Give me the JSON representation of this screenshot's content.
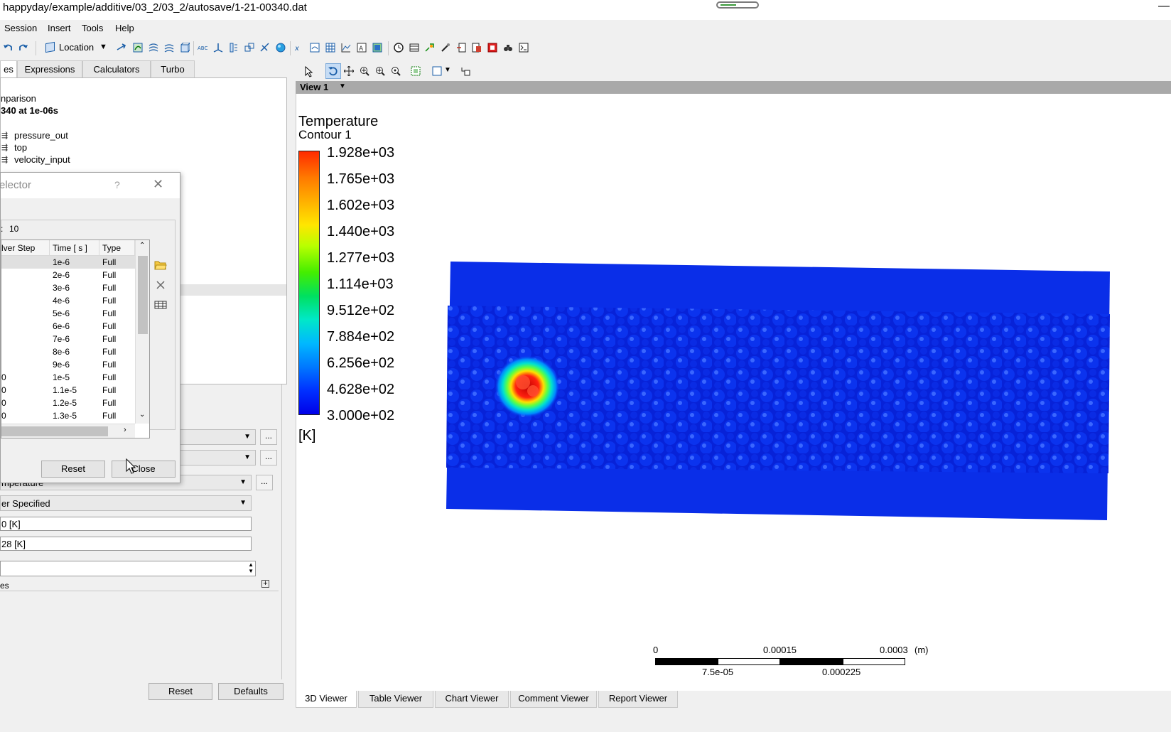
{
  "window": {
    "title": "happyday/example/additive/03_2/03_2/autosave/1-21-00340.dat",
    "minimize_glyph": "—"
  },
  "menu": [
    "Session",
    "Insert",
    "Tools",
    "Help"
  ],
  "toolbar": {
    "location_label": "Location",
    "icons": [
      "undo-icon",
      "redo-icon",
      "location-icon",
      "vector-icon",
      "streamline-icon",
      "particle-track-icon",
      "volume-rendering-icon",
      "isosurface-icon",
      "text-abc-icon",
      "coordinate-frame-icon",
      "legend-icon",
      "instance-transform-icon",
      "clip-plane-icon",
      "color-map-icon",
      "variable-icon",
      "expression-icon",
      "table-icon",
      "chart-icon",
      "comment-icon",
      "figure-icon",
      "timestep-clock-icon",
      "animation-icon",
      "quick-editor-icon",
      "probe-icon",
      "export-icon",
      "report-icon",
      "macro-icon",
      "command-editor-icon"
    ]
  },
  "left_tabs": [
    "es",
    "Expressions",
    "Calculators",
    "Turbo"
  ],
  "tree": {
    "item_comparison": "nparison",
    "item_case": "340 at 1e-06s",
    "boundaries": [
      "pressure_out",
      "top",
      "velocity_input"
    ]
  },
  "dialog": {
    "title": "elector",
    "help_glyph": "?",
    "close_glyph": "✕",
    "max_label": ":",
    "max_value": "10",
    "columns": [
      "lver Step",
      "Time [ s ]",
      "Type"
    ],
    "rows": [
      {
        "step": "",
        "time": "1e-6",
        "type": "Full"
      },
      {
        "step": "",
        "time": "2e-6",
        "type": "Full"
      },
      {
        "step": "",
        "time": "3e-6",
        "type": "Full"
      },
      {
        "step": "",
        "time": "4e-6",
        "type": "Full"
      },
      {
        "step": "",
        "time": "5e-6",
        "type": "Full"
      },
      {
        "step": "",
        "time": "6e-6",
        "type": "Full"
      },
      {
        "step": "",
        "time": "7e-6",
        "type": "Full"
      },
      {
        "step": "",
        "time": "8e-6",
        "type": "Full"
      },
      {
        "step": "",
        "time": "9e-6",
        "type": "Full"
      },
      {
        "step": "0",
        "time": "1e-5",
        "type": "Full"
      },
      {
        "step": "0",
        "time": "1.1e-5",
        "type": "Full"
      },
      {
        "step": "0",
        "time": "1.2e-5",
        "type": "Full"
      },
      {
        "step": "0",
        "time": "1.3e-5",
        "type": "Full"
      }
    ],
    "reset_label": "Reset",
    "close_label": "Close"
  },
  "details": {
    "variable_value": "mperature",
    "range_value": "er Specified",
    "min_value": "0 [K]",
    "max_value": "28 [K]",
    "spinner_value": "",
    "section_label": "es",
    "reset_label": "Reset",
    "defaults_label": "Defaults",
    "dots": "..."
  },
  "viewer": {
    "view_label": "View 1",
    "legend_title": "Temperature",
    "legend_subtitle": "Contour 1",
    "legend_values": [
      "1.928e+03",
      "1.765e+03",
      "1.602e+03",
      "1.440e+03",
      "1.277e+03",
      "1.114e+03",
      "9.512e+02",
      "7.884e+02",
      "6.256e+02",
      "4.628e+02",
      "3.000e+02"
    ],
    "legend_unit": "[K]",
    "scale": {
      "top_labels": [
        "0",
        "0.00015",
        "0.0003"
      ],
      "unit": "(m)",
      "bottom_labels": [
        "7.5e-05",
        "0.000225"
      ]
    }
  },
  "bottom_tabs": [
    "3D Viewer",
    "Table Viewer",
    "Chart Viewer",
    "Comment Viewer",
    "Report Viewer"
  ],
  "colors": {
    "hot": "#e01010",
    "cold": "#0a1ee0",
    "background": "#0a2de8"
  }
}
